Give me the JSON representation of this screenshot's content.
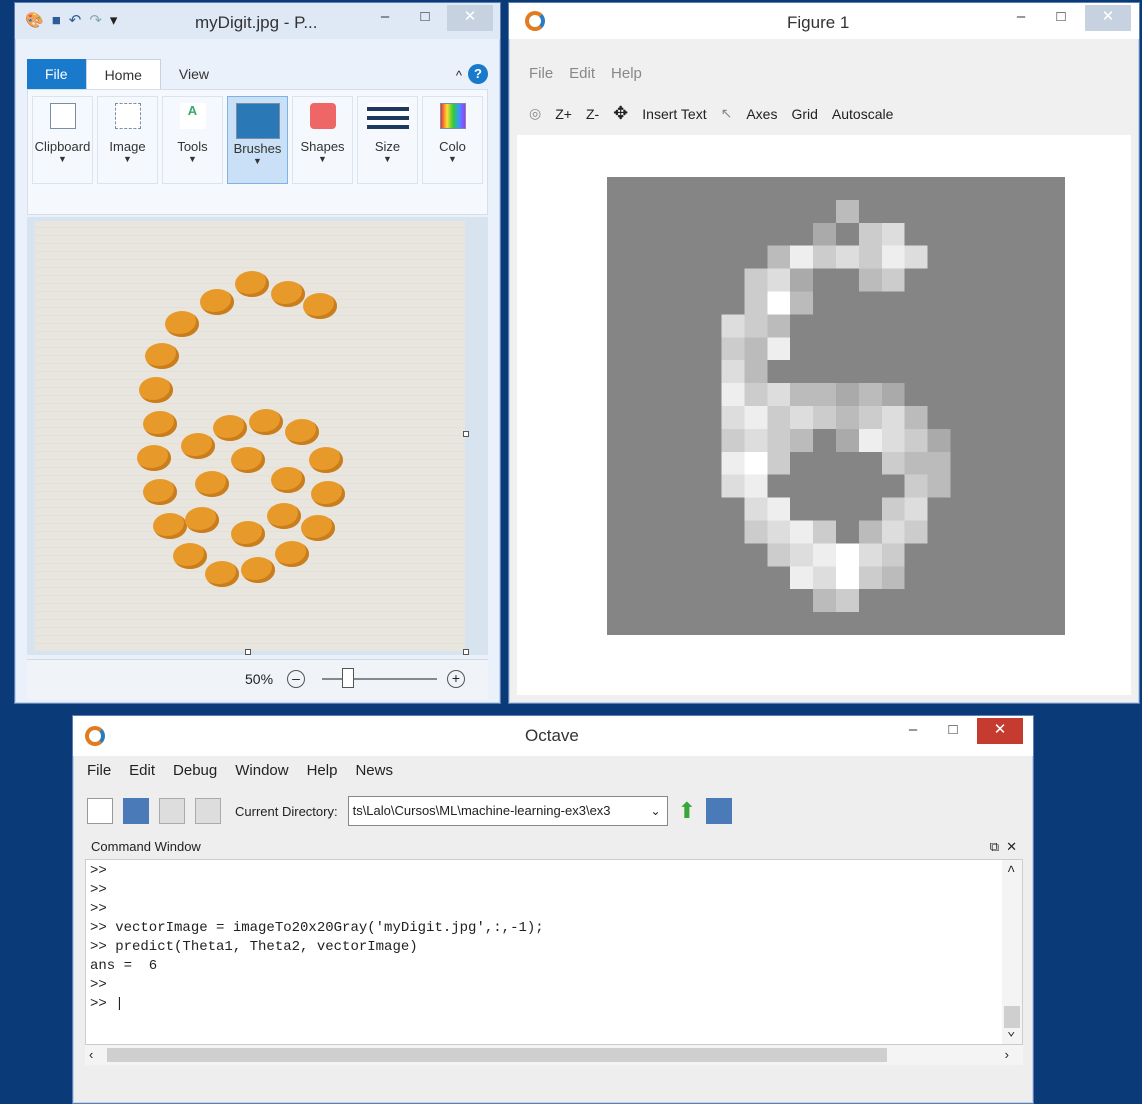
{
  "paint": {
    "title": "myDigit.jpg - P...",
    "tabs": [
      "File",
      "Home",
      "View"
    ],
    "groups": [
      "Clipboard",
      "Image",
      "Tools",
      "Brushes",
      "Shapes",
      "Size",
      "Colo"
    ],
    "zoom_label": "50%"
  },
  "figure": {
    "title": "Figure 1",
    "menu": [
      "File",
      "Edit",
      "Help"
    ],
    "toolbar": [
      "Z+",
      "Z-",
      "Insert Text",
      "Axes",
      "Grid",
      "Autoscale"
    ]
  },
  "octave": {
    "title": "Octave",
    "menu": [
      "File",
      "Edit",
      "Debug",
      "Window",
      "Help",
      "News"
    ],
    "current_directory_label": "Current Directory:",
    "current_directory_value": "ts\\Lalo\\Cursos\\ML\\machine-learning-ex3\\ex3",
    "command_window_title": "Command Window",
    "lines": [
      ">>",
      ">>",
      ">>",
      ">> vectorImage = imageTo20x20Gray('myDigit.jpg',:,-1);",
      ">> predict(Theta1, Theta2, vectorImage)",
      "ans =  6",
      ">>",
      ">> |"
    ]
  },
  "colors": {
    "desktop": "#0b3a78",
    "paint_accent": "#1979ca",
    "close_red": "#c63b30"
  }
}
